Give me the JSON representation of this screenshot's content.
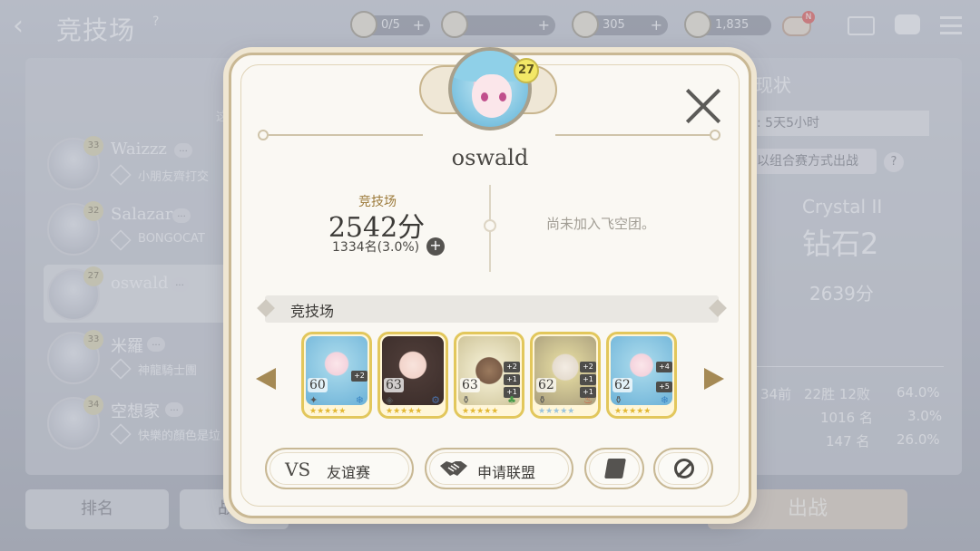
{
  "screen": {
    "title": "竞技场",
    "help": "?",
    "resources": [
      {
        "icon": "dice-icon",
        "value": "0/5",
        "plus": "+"
      },
      {
        "icon": "ticket-icon",
        "value": "",
        "plus": "+"
      },
      {
        "icon": "crystal-icon",
        "value": "305",
        "plus": "+"
      },
      {
        "icon": "coin-icon",
        "value": "1,835",
        "plus": ""
      }
    ],
    "notification_badge": "N"
  },
  "ranking_list": {
    "caption": "这",
    "rows": [
      {
        "level": "33",
        "name": "Waizzz",
        "guild": "小朋友齊打交"
      },
      {
        "level": "32",
        "name": "Salazar",
        "guild": "BONGOCAT"
      },
      {
        "level": "27",
        "name": "oswald",
        "guild": ""
      },
      {
        "level": "33",
        "name": "米羅",
        "guild": "神龍騎士團"
      },
      {
        "level": "34",
        "name": "空想家",
        "guild": "快樂的顏色是垃"
      }
    ],
    "more_badge": "..."
  },
  "status_panel": {
    "title": "现状",
    "time_left": "间: 5天5小时",
    "combo_mode": "始以组合赛方式出战",
    "help": "?",
    "tier_en": "Crystal II",
    "tier_cn": "钻石2",
    "tier_score": "2639分",
    "stats": [
      {
        "a": "34前",
        "b": "22胜 12败",
        "c": "64.0%"
      },
      {
        "a": "",
        "b": "1016 名",
        "c": "3.0%"
      },
      {
        "a": "",
        "b": "147 名",
        "c": "26.0%"
      }
    ]
  },
  "bottom_bar": {
    "ranking": "排名",
    "battle_log": "战斗",
    "fight": "出战"
  },
  "profile": {
    "level": "27",
    "name": "oswald",
    "arena_label": "竞技场",
    "arena_score": "2542分",
    "arena_rank": "1334名(3.0%)",
    "plus": "+",
    "guild_status": "尚未加入飞空团。",
    "section_title": "竞技场",
    "heroes": [
      {
        "level": "60",
        "boosts": [
          "+2"
        ],
        "class_icon": "✦",
        "element_icon": "❄"
      },
      {
        "level": "63",
        "boosts": [],
        "class_icon": "◈",
        "element_icon": "⚙"
      },
      {
        "level": "63",
        "boosts": [
          "+2",
          "+1",
          "+1"
        ],
        "class_icon": "⚱",
        "element_icon": "♣"
      },
      {
        "level": "62",
        "boosts": [
          "+2",
          "+1",
          "+1"
        ],
        "class_icon": "⚱",
        "element_icon": "♨"
      },
      {
        "level": "62",
        "boosts": [
          "+4",
          "+5"
        ],
        "class_icon": "⚱",
        "element_icon": "❄"
      }
    ],
    "stars": "★★★★★",
    "buttons": {
      "vs": "VS",
      "friendly_match": "友谊赛",
      "request_alliance": "申请联盟"
    }
  },
  "colors": {
    "modal_bg": "#faf8f3",
    "modal_border": "#c9b894",
    "accent_gold": "#9c7a3a",
    "hero_frame": "#e2c75c"
  }
}
